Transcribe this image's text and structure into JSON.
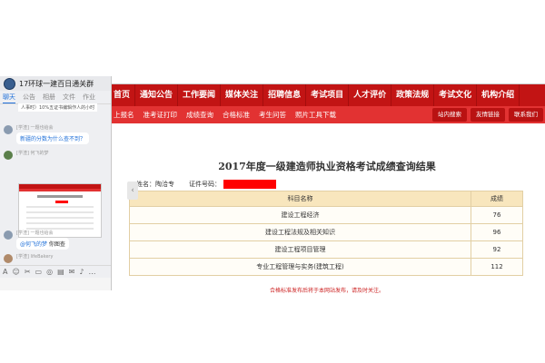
{
  "chat": {
    "group_name": "17环球一建百日通关群",
    "tabs": [
      "聊天",
      "公告",
      "相册",
      "文件",
      "作业"
    ],
    "top_clip_text": "人事时）10%五证书编辑作人的小时",
    "messages": [
      {
        "name": "[学渣] 一题也给会",
        "text": "新疆的分数为什么查不到？"
      },
      {
        "name": "[学渣] 何飞的梦",
        "text": ""
      },
      {
        "name": "[学渣] 一题也给会",
        "mention": "@何飞的梦",
        "text": " 你图查"
      },
      {
        "name": "[学渣] lifeBakery",
        "text": ""
      }
    ],
    "toolbar_icons": [
      "A",
      "☺",
      "✂",
      "▭",
      "◎",
      "▤",
      "✉",
      "♪",
      "…"
    ]
  },
  "site": {
    "nav": [
      "首页",
      "通知公告",
      "工作要闻",
      "媒体关注",
      "招聘信息",
      "考试项目",
      "人才评价",
      "政策法规",
      "考试文化",
      "机构介绍"
    ],
    "subnav": [
      "上报名",
      "准考证打印",
      "成绩查询",
      "合格标准",
      "考生问答",
      "照片工具下载"
    ],
    "right_buttons": [
      "站内搜索",
      "友情链接",
      "联系我们"
    ],
    "result_title": "2017年度一级建造师执业资格考试成绩查询结果",
    "name_label": "姓名：",
    "name_value": "陶洽专",
    "id_label": "证件号码：",
    "table": {
      "header_subject": "科目名称",
      "header_score": "成绩",
      "rows": [
        {
          "subject": "建设工程经济",
          "score": "76"
        },
        {
          "subject": "建设工程法规及相关知识",
          "score": "96"
        },
        {
          "subject": "建设工程项目管理",
          "score": "92"
        },
        {
          "subject": "专业工程管理与实务(建筑工程)",
          "score": "112"
        }
      ]
    },
    "footnote": "合格标准发布后将于本网站发布，请及时关注。"
  },
  "colors": {
    "nav_red": "#c21414",
    "subnav_red": "#e23232",
    "redaction": "#ff0000",
    "table_header": "#f8e6bd"
  },
  "icons": {
    "prev_arrow": "‹"
  }
}
